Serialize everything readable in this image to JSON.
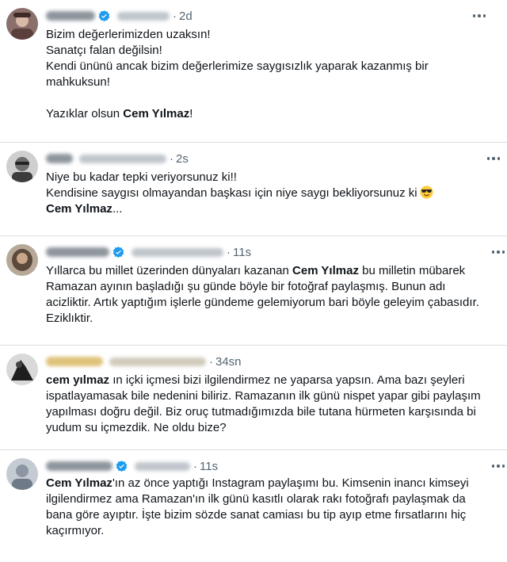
{
  "tweets": [
    {
      "time": "2d",
      "lines": [
        {
          "text": "Bizim değerlerimizden uzaksın!"
        },
        {
          "text": "Sanatçı falan değilsin!"
        },
        {
          "text": "Kendi ününü ancak bizim değerlerimize saygısızlık yaparak kazanmış bir mahkuksun!"
        },
        {
          "text": ""
        },
        {
          "pre": "Yazıklar olsun ",
          "bold": "Cem Yılmaz",
          "post": "!"
        }
      ]
    },
    {
      "time": "2s",
      "lines": [
        {
          "text": "Niye bu kadar tepki veriyorsunuz ki!!"
        },
        {
          "text": "Kendisine saygısı olmayandan başkası için niye saygı bekliyorsunuz ki",
          "emoji": "sunglasses-emoji"
        },
        {
          "bold": "Cem Yılmaz",
          "post": "..."
        }
      ]
    },
    {
      "time": "11s",
      "lines": [
        {
          "pre": "Yıllarca bu millet üzerinden dünyaları kazanan ",
          "bold": "Cem Yılmaz",
          "post": " bu milletin mübarek Ramazan ayının başladığı şu günde böyle bir fotoğraf paylaşmış. Bunun adı acizliktir. Artık yaptığım işlerle gündeme gelemiyorum bari böyle geleyim çabasıdır. Eziklıktir."
        }
      ]
    },
    {
      "time": "34sn",
      "lines": [
        {
          "bold": "cem yılmaz",
          "post": " ın içki içmesi bizi ilgilendirmez ne yaparsa yapsın. Ama bazı şeyleri ispatlayamasak bile nedenini biliriz. Ramazanın ilk günü nispet yapar gibi paylaşım yapılması doğru değil. Biz oruç tutmadığımızda bile tutana hürmeten karşısında bi yudum su içmezdik. Ne oldu bize?"
        }
      ]
    },
    {
      "time": "11s",
      "lines": [
        {
          "bold": "Cem Yılmaz",
          "post": "'ın az önce yaptığı Instagram paylaşımı bu. Kimsenin inancı kimseyi ilgilendirmez ama Ramazan'ın ilk günü kasıtlı olarak rakı fotoğrafı paylaşmak da bana göre ayıptır. İşte bizim sözde sanat camiası bu tip ayıp etme fırsatlarını hiç kaçırmıyor."
        }
      ]
    }
  ],
  "colors": {
    "text": "#0f1419",
    "secondary": "#536471",
    "verified": "#1d9bf0",
    "divider": "#d9dde1"
  },
  "icons": {
    "more": "more-dots-icon",
    "verified": "verified-badge-icon",
    "emoji": "sunglasses-emoji"
  }
}
